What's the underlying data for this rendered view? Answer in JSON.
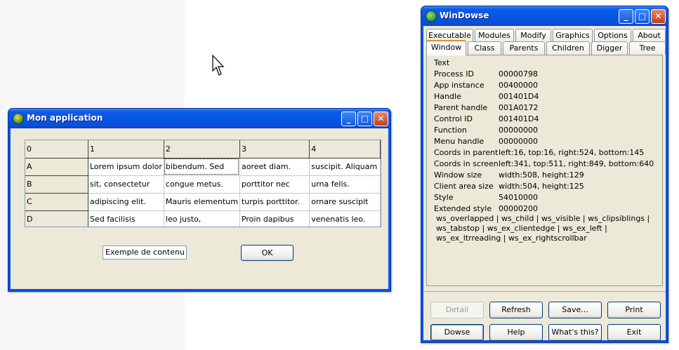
{
  "app_window": {
    "title": "Mon application",
    "grid": {
      "rows": [
        [
          "0",
          "1",
          "2",
          "3",
          "4"
        ],
        [
          "A",
          "Lorem ipsum dolor",
          "bibendum. Sed",
          "aoreet diam.",
          "suscipit. Aliquam"
        ],
        [
          "B",
          "sit, consectetur",
          "congue metus.",
          "porttitor nec",
          "urna felis."
        ],
        [
          "C",
          "adipiscing elit.",
          "Mauris elementum",
          "turpis porttitor.",
          "ornare suscipit"
        ],
        [
          "D",
          "Sed facilisis",
          "leo justo,",
          "Proin dapibus",
          "venenatis leo."
        ]
      ]
    },
    "edit_value": "Exemple de contenu",
    "ok_label": "OK"
  },
  "windowse": {
    "title": "WinDowse",
    "tabs_row1": [
      "Executable",
      "Modules",
      "Modify",
      "Graphics",
      "Options",
      "About"
    ],
    "tabs_row2": [
      "Window",
      "Class",
      "Parents",
      "Children",
      "Digger",
      "Tree"
    ],
    "active_tab": "Window",
    "fields": [
      {
        "label": "Text",
        "value": ""
      },
      {
        "label": "Process ID",
        "value": "00000798"
      },
      {
        "label": "App instance",
        "value": "00400000"
      },
      {
        "label": "Handle",
        "value": "001401D4"
      },
      {
        "label": "Parent handle",
        "value": "001A0172"
      },
      {
        "label": "Control ID",
        "value": "001401D4"
      },
      {
        "label": "Function",
        "value": "00000000"
      },
      {
        "label": "Menu handle",
        "value": "00000000"
      },
      {
        "label": "Coords in parent",
        "value": "left:16, top:16, right:524, bottom:145"
      },
      {
        "label": "Coords in screen",
        "value": "left:341, top:511, right:849, bottom:640"
      },
      {
        "label": "Window size",
        "value": "width:508, height:129"
      },
      {
        "label": "Client area size",
        "value": "width:504, height:125"
      },
      {
        "label": "Style",
        "value": "54010000"
      },
      {
        "label": "Extended style",
        "value": "00000200"
      }
    ],
    "style_flags": "ws_overlapped | ws_child | ws_visible | ws_clipsiblings | ws_tabstop | ws_ex_clientedge | ws_ex_left | ws_ex_ltrreading | ws_ex_rightscrollbar",
    "buttons": {
      "detail": "Detail",
      "refresh": "Refresh",
      "save": "Save...",
      "print": "Print",
      "dowse": "Dowse",
      "help": "Help",
      "whats_this": "What's this?",
      "exit": "Exit"
    }
  },
  "colors": {
    "xp_title": "#0a54e4",
    "dialog_bg": "#ece9d8",
    "close_button": "#c2401c",
    "active_tab_accent": "#e68b2c"
  }
}
